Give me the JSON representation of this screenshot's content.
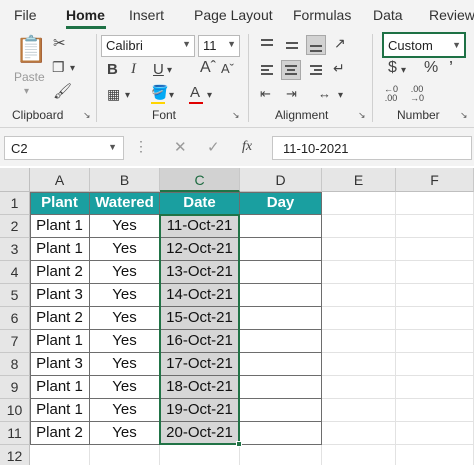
{
  "menu": {
    "tabs": [
      "File",
      "Home",
      "Insert",
      "Page Layout",
      "Formulas",
      "Data",
      "Review"
    ],
    "active": "Home"
  },
  "ribbon": {
    "clipboard": {
      "label": "Clipboard",
      "paste_label": "Paste"
    },
    "font": {
      "label": "Font",
      "name": "Calibri",
      "size": "11"
    },
    "alignment": {
      "label": "Alignment"
    },
    "number": {
      "label": "Number",
      "format": "Custom"
    }
  },
  "formula_bar": {
    "name_box": "C2",
    "fx": "fx",
    "formula": "11-10-2021"
  },
  "sheet": {
    "columns": [
      "A",
      "B",
      "C",
      "D",
      "E",
      "F"
    ],
    "row_numbers": [
      "1",
      "2",
      "3",
      "4",
      "5",
      "6",
      "7",
      "8",
      "9",
      "10",
      "11",
      "12"
    ],
    "headers": [
      "Plant",
      "Watered",
      "Date",
      "Day"
    ],
    "rows": [
      [
        "Plant 1",
        "Yes",
        "11-Oct-21",
        ""
      ],
      [
        "Plant 1",
        "Yes",
        "12-Oct-21",
        ""
      ],
      [
        "Plant 2",
        "Yes",
        "13-Oct-21",
        ""
      ],
      [
        "Plant 3",
        "Yes",
        "14-Oct-21",
        ""
      ],
      [
        "Plant 2",
        "Yes",
        "15-Oct-21",
        ""
      ],
      [
        "Plant 1",
        "Yes",
        "16-Oct-21",
        ""
      ],
      [
        "Plant 3",
        "Yes",
        "17-Oct-21",
        ""
      ],
      [
        "Plant 1",
        "Yes",
        "18-Oct-21",
        ""
      ],
      [
        "Plant 1",
        "Yes",
        "19-Oct-21",
        ""
      ],
      [
        "Plant 2",
        "Yes",
        "20-Oct-21",
        ""
      ]
    ],
    "selected_column": "C",
    "header_fill": "#1a9fa0",
    "selection_color": "#217346"
  }
}
